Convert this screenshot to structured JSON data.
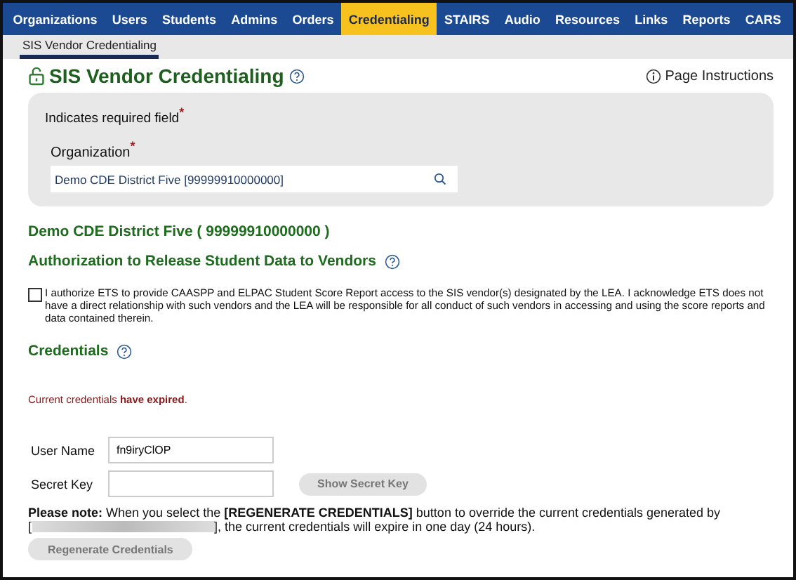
{
  "nav": {
    "items": [
      {
        "label": "Organizations",
        "selected": false
      },
      {
        "label": "Users",
        "selected": false
      },
      {
        "label": "Students",
        "selected": false
      },
      {
        "label": "Admins",
        "selected": false
      },
      {
        "label": "Orders",
        "selected": false
      },
      {
        "label": "Credentialing",
        "selected": true
      },
      {
        "label": "STAIRS",
        "selected": false
      },
      {
        "label": "Audio",
        "selected": false
      },
      {
        "label": "Resources",
        "selected": false
      },
      {
        "label": "Links",
        "selected": false
      },
      {
        "label": "Reports",
        "selected": false
      },
      {
        "label": "CARS",
        "selected": false
      }
    ]
  },
  "subtabs": [
    {
      "label": "SIS Vendor Credentialing",
      "selected": true
    }
  ],
  "page": {
    "title": "SIS Vendor Credentialing",
    "instructions": "Page Instructions"
  },
  "form": {
    "required_note": "Indicates required field",
    "required_mark": "*",
    "organization": {
      "label": "Organization",
      "required_mark": "*",
      "value": "Demo CDE District Five [99999910000000]"
    }
  },
  "org_heading": "Demo CDE District Five ( 99999910000000 )",
  "authorization": {
    "heading": "Authorization to Release Student Data to Vendors",
    "checked": false,
    "text": "I authorize ETS to provide CAASPP and ELPAC Student Score Report access to the SIS vendor(s) designated by the LEA. I acknowledge ETS does not have a direct relationship with such vendors and the LEA will be responsible for all conduct of such vendors in accessing and using the score reports and data contained therein."
  },
  "credentials": {
    "heading": "Credentials",
    "status": "Current credentials **have expired**.",
    "fields": [
      {
        "label": "User Name",
        "value": "fn9iryClOP"
      },
      {
        "label": "Secret Key"
      }
    ],
    "show_button": {
      "label": "Show Secret Key",
      "disabled": true
    },
    "note_before": "**Please note:** When you select the **[REGENERATE CREDENTIALS]** button to override the current credentials generated by",
    "note_open": "[",
    "note_after": "], the current credentials will expire in one day (24 hours).",
    "regenerate_button": {
      "label": "Regenerate Credentials",
      "disabled": true
    }
  }
}
